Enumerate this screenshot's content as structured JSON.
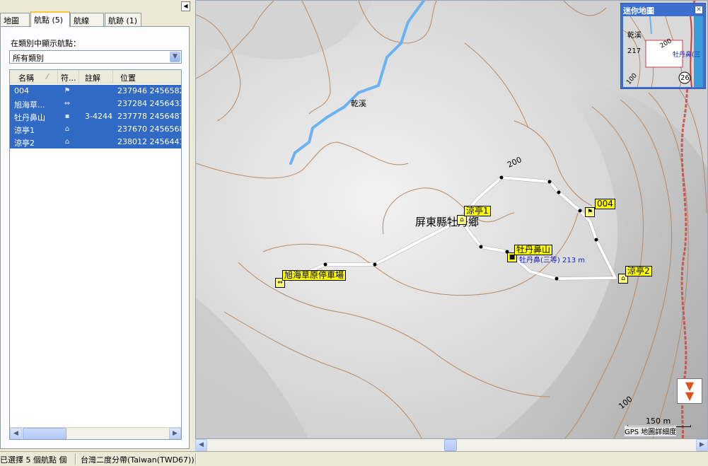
{
  "tabs": [
    {
      "label": "地圖"
    },
    {
      "label": "航點 (5)"
    },
    {
      "label": "航線"
    },
    {
      "label": "航跡 (1)"
    }
  ],
  "filter": {
    "label": "在類別中顯示航點：",
    "selected": "所有類別"
  },
  "table": {
    "headers": [
      "名稱",
      "符...",
      "註解",
      "位置"
    ],
    "rows": [
      {
        "name": "004",
        "symbol": "flag-icon",
        "comment": "",
        "position": "237946 2456582"
      },
      {
        "name": "旭海草...",
        "symbol": "parking-icon",
        "comment": "",
        "position": "237284 2456433"
      },
      {
        "name": "牡丹鼻山",
        "symbol": "summit-icon",
        "comment": "3-4244",
        "position": "237778 2456487"
      },
      {
        "name": "涼亭1",
        "symbol": "shelter-icon",
        "comment": "",
        "position": "237670 2456568"
      },
      {
        "name": "涼亭2",
        "symbol": "shelter-icon",
        "comment": "",
        "position": "238012 2456441"
      }
    ]
  },
  "map": {
    "labels": {
      "creek": "乾溪",
      "region": "屏東縣牡丹鄉",
      "contour_200": "200",
      "contour_100": "100"
    },
    "waypoints": {
      "wp_004": "004",
      "pavilion1": "涼亭1",
      "pavilion2": "涼亭2",
      "peak": "牡丹鼻山",
      "peak_note": "牡丹鼻(三等) 213 m",
      "parking": "旭海草原停車場"
    },
    "colors": {
      "track": "#ffffff",
      "label_bg": "#ffff00",
      "creek": "#6ab2f0",
      "contour": "#b68a6a"
    }
  },
  "minimap": {
    "title": "迷你地圖",
    "labels": {
      "creek": "乾溪",
      "elev": "217",
      "contour": "200",
      "peak": "牡丹鼻(三",
      "road": "26",
      "contour_low": "100"
    }
  },
  "scale": {
    "value": "150 m",
    "caption": "GPS 地圖詳細度"
  },
  "status": {
    "selection": "已選擇 5 個航點 個",
    "datum": "台灣二度分帶(Taiwan(TWD67))"
  }
}
